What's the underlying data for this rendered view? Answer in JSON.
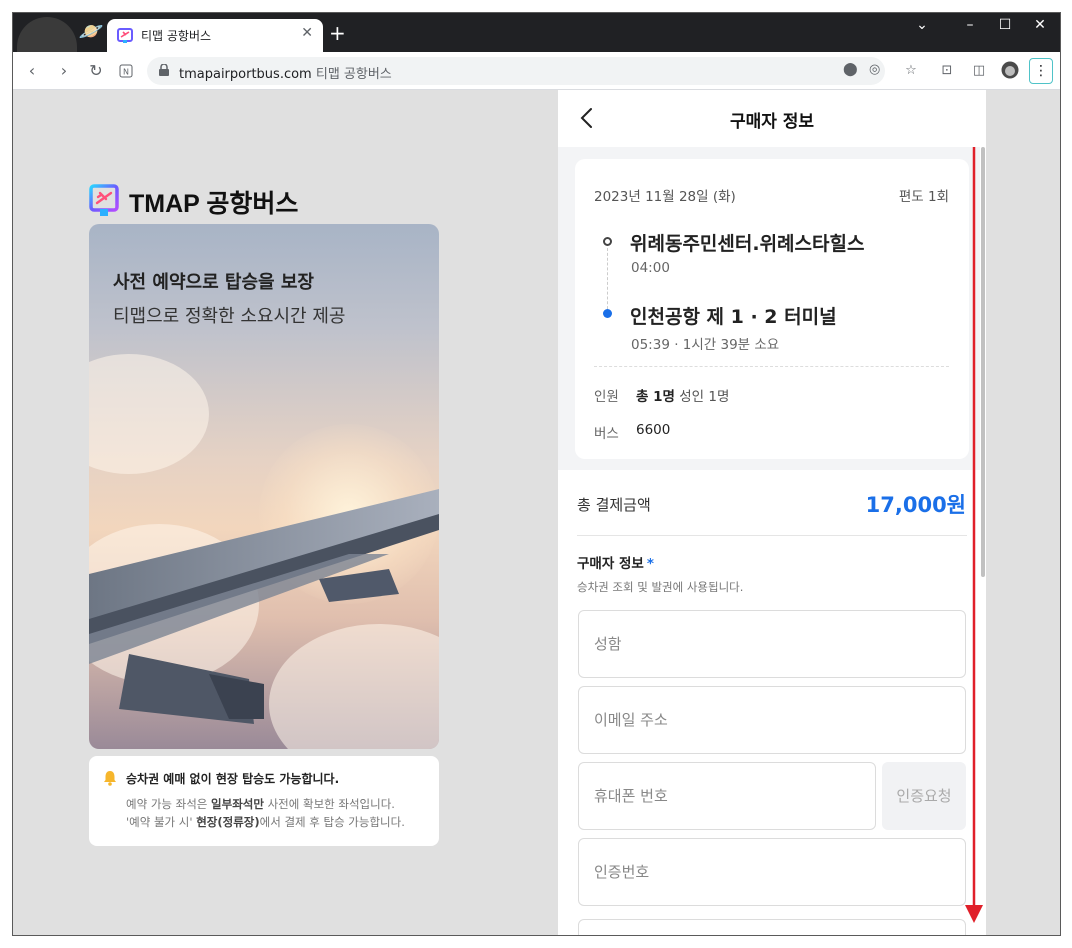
{
  "browser": {
    "tab_title": "티맵 공항버스",
    "tab_close": "✕",
    "new_tab": "+",
    "url": "tmapairportbus.com",
    "page_title": "티맵 공항버스"
  },
  "brand": {
    "logo_text": "TMAP 공항버스",
    "accent": "#1a6fe8"
  },
  "hero": {
    "title": "사전 예약으로 탑승을 보장",
    "subtitle": "티맵으로 정확한 소요시간 제공"
  },
  "notice": {
    "title": "승차권 예매 없이 현장 탑승도 가능합니다.",
    "line1_pre": "예약 가능 좌석은 ",
    "line1_bold": "일부좌석만",
    "line1_post": " 사전에 확보한 좌석입니다.",
    "line2_pre": "'예약 불가 시' ",
    "line2_bold": "현장(정류장)",
    "line2_post": "에서 결제 후 탑승 가능합니다."
  },
  "panel": {
    "title": "구매자 정보"
  },
  "trip": {
    "date": "2023년 11월 28일 (화)",
    "trip_type": "편도 1회",
    "origin_name": "위례동주민센터.위례스타힐스",
    "origin_time": "04:00",
    "destination_name": "인천공항 제 1 · 2 터미널",
    "destination_time": "05:39 · 1시간 39분 소요",
    "people_label": "인원",
    "people_total": "총 1명",
    "people_detail": " 성인 1명",
    "bus_label": "버스",
    "bus_number": "6600"
  },
  "payment": {
    "total_label": "총 결제금액",
    "total_value": "17,000원"
  },
  "buyer": {
    "section_title": "구매자 정보",
    "required_mark": "*",
    "description": "승차권 조회 및 발권에 사용됩니다.",
    "name_placeholder": "성함",
    "email_placeholder": "이메일 주소",
    "phone_placeholder": "휴대폰 번호",
    "verify_button": "인증요청",
    "code_placeholder": "인증번호"
  }
}
